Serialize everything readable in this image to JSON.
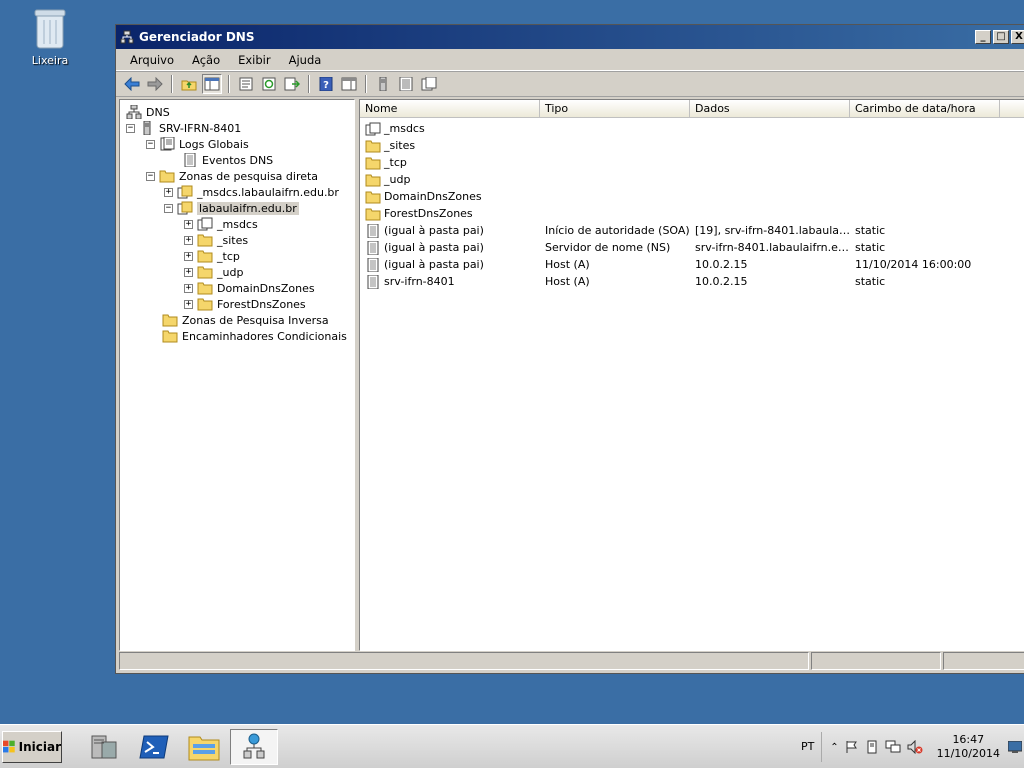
{
  "desktop": {
    "recycle_bin_label": "Lixeira"
  },
  "window": {
    "title": "Gerenciador DNS",
    "buttons": {
      "minimize": "_",
      "maximize": "□",
      "close": "X"
    }
  },
  "menu": [
    "Arquivo",
    "Ação",
    "Exibir",
    "Ajuda"
  ],
  "tree": {
    "root": "DNS",
    "server": "SRV-IFRN-8401",
    "global_logs": "Logs Globais",
    "dns_events": "Eventos DNS",
    "forward_zones": "Zonas de pesquisa direta",
    "msdcs_zone": "_msdcs.labaulaifrn.edu.br",
    "main_zone": "labaulaifrn.edu.br",
    "subfolders": [
      "_msdcs",
      "_sites",
      "_tcp",
      "_udp",
      "DomainDnsZones",
      "ForestDnsZones"
    ],
    "reverse_zones": "Zonas de Pesquisa Inversa",
    "conditional_forwarders": "Encaminhadores Condicionais",
    "expander_plus": "+",
    "expander_minus": "−"
  },
  "list": {
    "columns": [
      "Nome",
      "Tipo",
      "Dados",
      "Carimbo de data/hora"
    ],
    "rows": [
      {
        "name": "_msdcs",
        "type": "",
        "data": "",
        "stamp": "",
        "icon": "zone-icon"
      },
      {
        "name": "_sites",
        "type": "",
        "data": "",
        "stamp": "",
        "icon": "folder-icon"
      },
      {
        "name": "_tcp",
        "type": "",
        "data": "",
        "stamp": "",
        "icon": "folder-icon"
      },
      {
        "name": "_udp",
        "type": "",
        "data": "",
        "stamp": "",
        "icon": "folder-icon"
      },
      {
        "name": "DomainDnsZones",
        "type": "",
        "data": "",
        "stamp": "",
        "icon": "folder-icon"
      },
      {
        "name": "ForestDnsZones",
        "type": "",
        "data": "",
        "stamp": "",
        "icon": "folder-icon"
      },
      {
        "name": "(igual à pasta pai)",
        "type": "Início de autoridade (SOA)",
        "data": "[19], srv-ifrn-8401.labaulaif...",
        "stamp": "static",
        "icon": "record-icon"
      },
      {
        "name": "(igual à pasta pai)",
        "type": "Servidor de nome (NS)",
        "data": "srv-ifrn-8401.labaulaifrn.ed...",
        "stamp": "static",
        "icon": "record-icon"
      },
      {
        "name": "(igual à pasta pai)",
        "type": "Host (A)",
        "data": "10.0.2.15",
        "stamp": "11/10/2014 16:00:00",
        "icon": "record-icon"
      },
      {
        "name": "srv-ifrn-8401",
        "type": "Host (A)",
        "data": "10.0.2.15",
        "stamp": "static",
        "icon": "record-icon"
      }
    ]
  },
  "taskbar": {
    "start_label": "Iniciar",
    "language": "PT",
    "time": "16:47",
    "date": "11/10/2014"
  },
  "colors": {
    "desktop": "#3a6ea5",
    "titlebar": "#0a246a",
    "folder": "#f5d66b"
  }
}
